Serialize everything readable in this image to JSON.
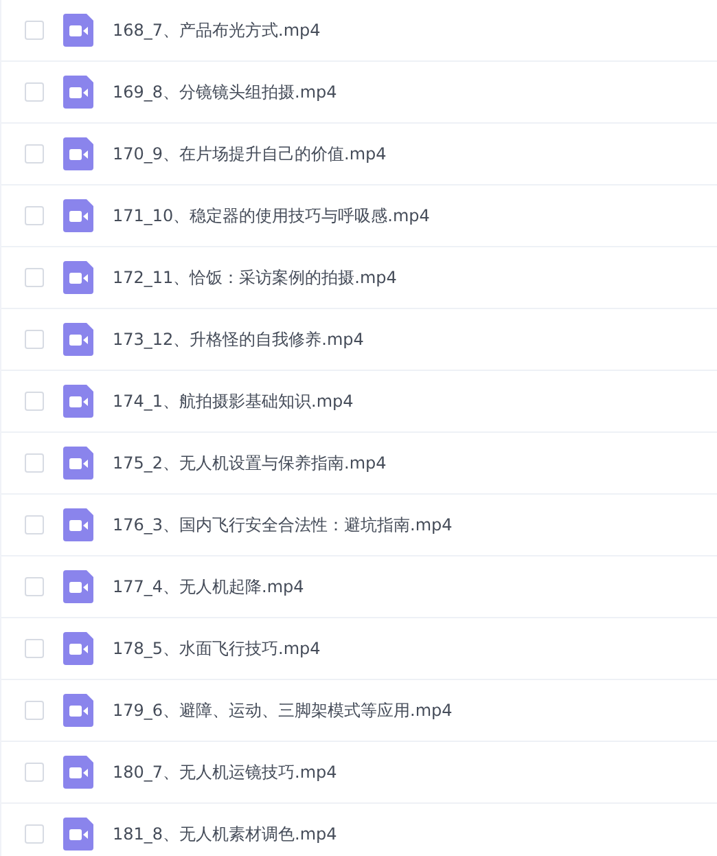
{
  "files": [
    {
      "name": "168_7、产品布光方式.mp4",
      "checked": false
    },
    {
      "name": "169_8、分镜镜头组拍摄.mp4",
      "checked": false
    },
    {
      "name": "170_9、在片场提升自己的价值.mp4",
      "checked": false
    },
    {
      "name": "171_10、稳定器的使用技巧与呼吸感.mp4",
      "checked": false
    },
    {
      "name": "172_11、恰饭：采访案例的拍摄.mp4",
      "checked": false
    },
    {
      "name": "173_12、升格怪的自我修养.mp4",
      "checked": false
    },
    {
      "name": "174_1、航拍摄影基础知识.mp4",
      "checked": false
    },
    {
      "name": "175_2、无人机设置与保养指南.mp4",
      "checked": false
    },
    {
      "name": "176_3、国内飞行安全合法性：避坑指南.mp4",
      "checked": false
    },
    {
      "name": "177_4、无人机起降.mp4",
      "checked": false
    },
    {
      "name": "178_5、水面飞行技巧.mp4",
      "checked": false
    },
    {
      "name": "179_6、避障、运动、三脚架模式等应用.mp4",
      "checked": false
    },
    {
      "name": "180_7、无人机运镜技巧.mp4",
      "checked": false
    },
    {
      "name": "181_8、无人机素材调色.mp4",
      "checked": false
    }
  ]
}
